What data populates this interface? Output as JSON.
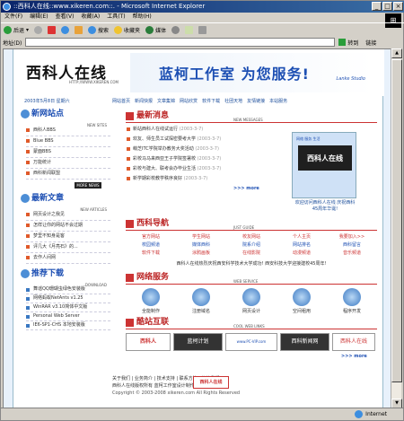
{
  "window": {
    "title": "::西科人在线::www.xikeren.com::. - Microsoft Internet Explorer"
  },
  "menu": [
    "文件(F)",
    "编辑(E)",
    "查看(V)",
    "收藏(A)",
    "工具(T)",
    "帮助(H)"
  ],
  "toolbar": {
    "back": "后退",
    "search": "搜索",
    "favorites": "收藏夹",
    "media": "媒体"
  },
  "address": {
    "label": "地址(D)",
    "value": "",
    "go": "转到",
    "links": "链接"
  },
  "status": {
    "left": "",
    "zone": "Internet"
  },
  "colors": {
    "accent": "#1d4fb3",
    "red": "#cc3333",
    "bg": "#e8f1fb"
  },
  "site": {
    "logo": "西科人在线",
    "logo_url": "HTTP://WWW.XIKEREN.COM",
    "banner": "蓝柯工作室 为您服务!",
    "banner_sub": "Lanke Studio",
    "nav": [
      "网站首页",
      "新闻快报",
      "文章集锦",
      "网站欣赏",
      "软件下载",
      "社团天地",
      "友情链接",
      "本站服务"
    ],
    "date": "2003年5月8日 星期六",
    "sites": {
      "title": "新网站点",
      "en": "NEW SITES",
      "items": [
        "西科人BBS",
        "Blue BBS",
        "蒙面BBS",
        "万能统计",
        "西科新闻联盟"
      ],
      "more": "MORE NEWS"
    },
    "articles": {
      "title": "最新文章",
      "en": "NEW ARTICLES",
      "items": [
        "网页设计之我见",
        "怎样让你的网站不会过期",
        "梦里不知身是客",
        "评几大《月亮石》的...",
        "去作人间网"
      ]
    },
    "downloads": {
      "title": "推荐下载",
      "en": "DOWNLOAD",
      "items": [
        "舞谣QQ珊瑚虫绿色安装版",
        "网络蚂蚁NetAnts v1.25",
        "WinRAR v3.10简体中文版",
        "Personal Web Server",
        "IE6-SP1-CHS 本地安装版"
      ]
    },
    "news": {
      "title": "最新消息",
      "en": "NEW MESSAGES",
      "items": [
        {
          "t": "新站西科人在线试运行",
          "d": "(2003-3-7)"
        },
        {
          "t": "欢友、师生员工试探密要考大学",
          "d": "(2003-3-7)"
        },
        {
          "t": "萌芝ITC学院举办教务大奖活动",
          "d": "(2003-3-7)"
        },
        {
          "t": "彩校马马来西亚王子学院签署校",
          "d": "(2003-3-7)"
        },
        {
          "t": "彩校与建大、联考会办毕业生活",
          "d": "(2003-3-7)"
        },
        {
          "t": "新学期彩校教学秩序良好",
          "d": "(2003-3-7)"
        }
      ],
      "more": ">>> more"
    },
    "promo": {
      "top": "网络 服务 生活",
      "logo": "西科人在线",
      "caption": "欢迎访问西科人在线 庆祝西科45周年华诞!"
    },
    "guide": {
      "title": "西科导航",
      "en": "JUST GUIDE",
      "cells": [
        "官方网站",
        "学生网站",
        "校友网站",
        "个人主页",
        "我要加入>>",
        "校园频道",
        "媒体西科",
        "院系介绍",
        "网站排名",
        "西科留言",
        "软件下载",
        "涂鸦画板",
        "在线影院",
        "动漫频道",
        "音乐频道"
      ],
      "foot": "西科人在线热烈庆祝西安科学技术大学成功!   西安科技大学迎接建校45周年!"
    },
    "services": {
      "title": "网络服务",
      "en": "WEB SERVICE",
      "items": [
        "全能制作",
        "注册域名",
        "网页设计",
        "空间租用",
        "程序开发"
      ]
    },
    "friends": {
      "title": "酷站互联",
      "en": "COOL WEB LINKS",
      "items": [
        "西科人",
        "蓝柯计划",
        "www.PC-VIP.com",
        "西科新闻网",
        "西科人在线"
      ],
      "more": ">>> more"
    },
    "footer": {
      "links": "关于我们 | 业务简介 | 技术支持 | 联系方法 | 链接我们",
      "line2": "西科人在线版权所有   蓝柯工作室设计制作",
      "copy": "Copyright © 2003-2008 xikeren.com All Rights Reserved",
      "foot_logo": "西科人在线"
    }
  }
}
